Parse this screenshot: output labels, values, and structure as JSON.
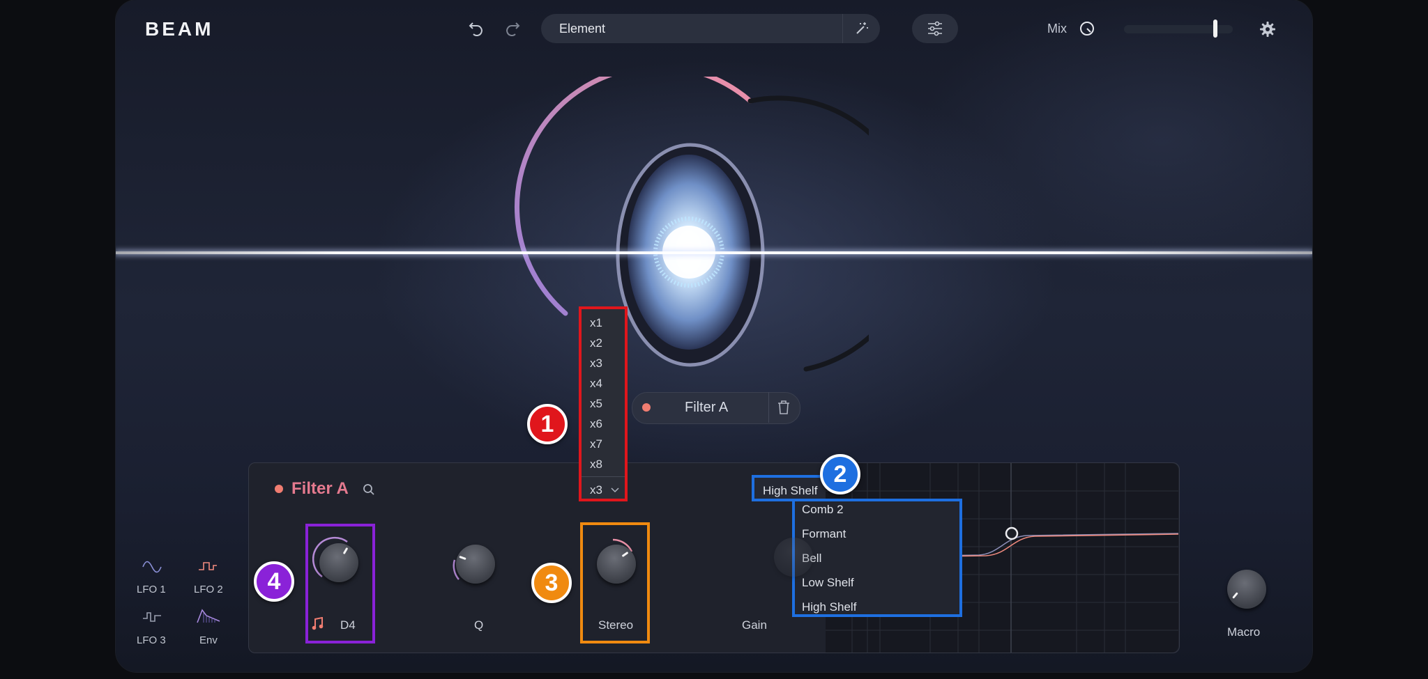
{
  "header": {
    "logo": "BEAM",
    "preset_name": "Element",
    "mix_label": "Mix",
    "mix_value": 0.84,
    "icons": [
      "undo-icon",
      "redo-icon",
      "magic-wand-icon",
      "sliders-icon",
      "mix-knob-icon",
      "gear-icon"
    ]
  },
  "filter_pill": {
    "label": "Filter A"
  },
  "panel": {
    "title": "Filter A",
    "multiplier": {
      "options": [
        "x1",
        "x2",
        "x3",
        "x4",
        "x5",
        "x6",
        "x7",
        "x8"
      ],
      "selected": "x3"
    },
    "filter_type": {
      "selected": "High Shelf",
      "options": [
        "Comb 2",
        "Formant",
        "Bell",
        "Low Shelf",
        "High Shelf"
      ]
    },
    "knobs": {
      "freq_value": "D4",
      "q_label": "Q",
      "stereo_label": "Stereo",
      "gain_label": "Gain"
    }
  },
  "modulators": [
    "LFO 1",
    "LFO 2",
    "LFO 3",
    "Env"
  ],
  "macro_label": "Macro",
  "annotations": [
    "1",
    "2",
    "3",
    "4"
  ],
  "colors": {
    "accent_pink": "#e57a8f",
    "dot_red": "#f07d71",
    "annot_red": "#e0161c",
    "annot_blue": "#1e6fe0",
    "annot_orange": "#f08a10",
    "annot_purple": "#8a22d8"
  }
}
